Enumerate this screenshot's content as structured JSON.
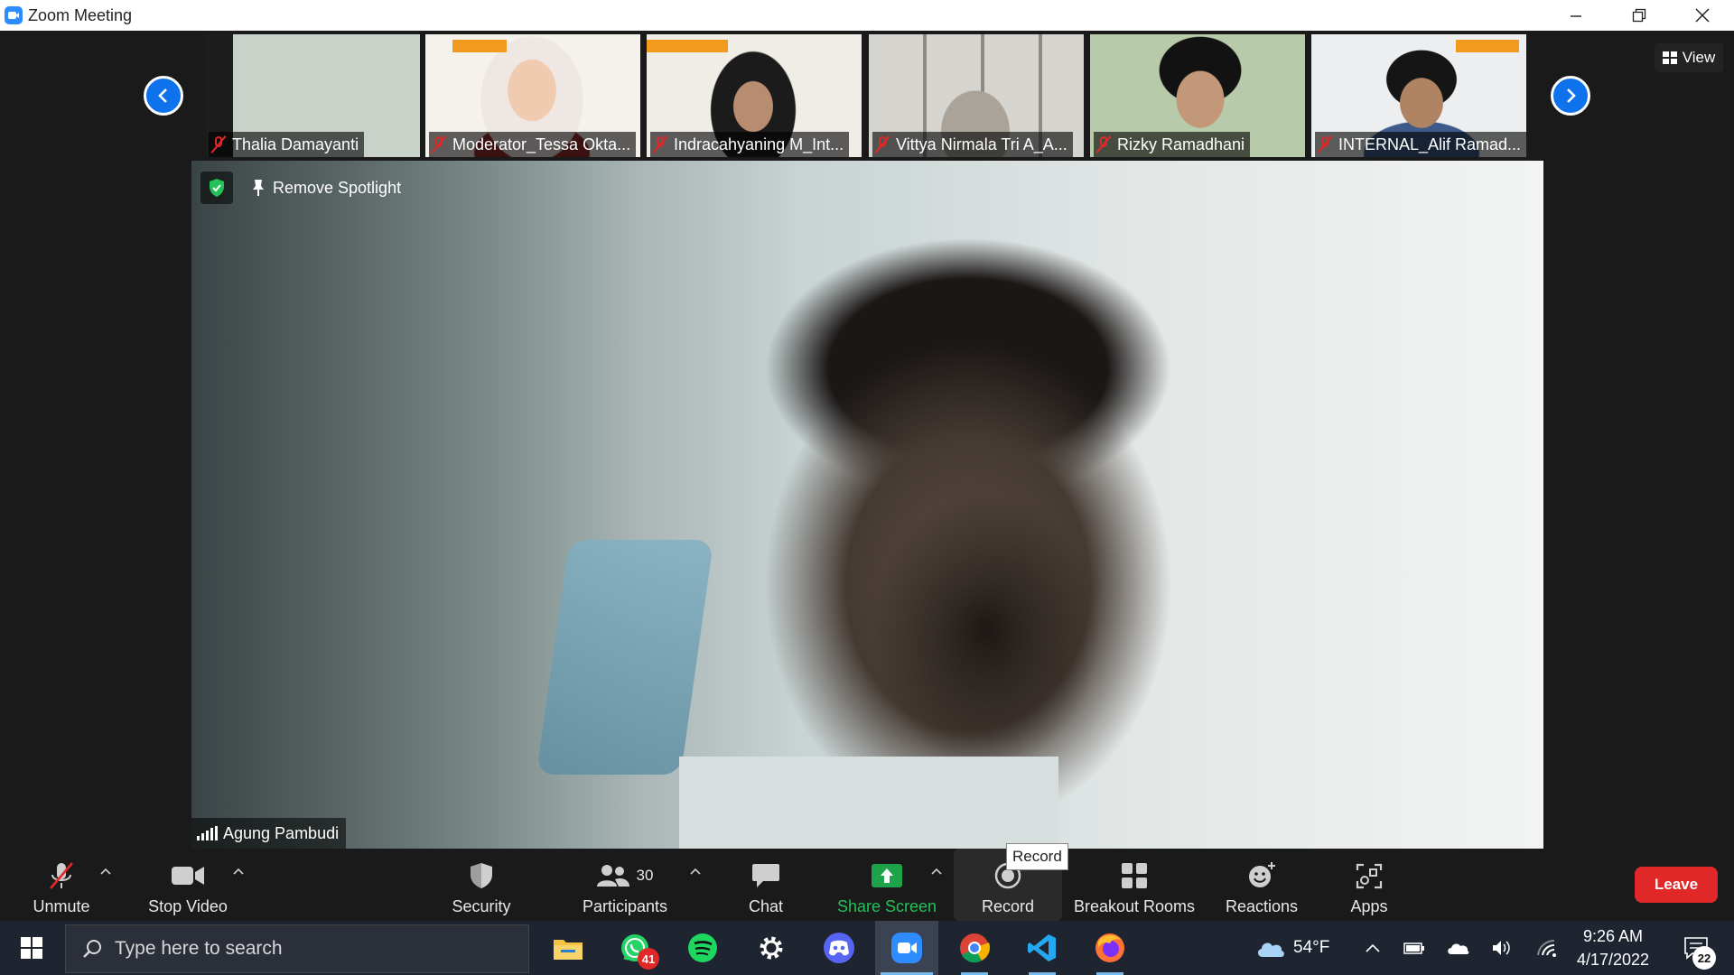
{
  "window": {
    "title": "Zoom Meeting"
  },
  "gallery": {
    "view_label": "View",
    "tiles": [
      {
        "name": "Thalia Damayanti",
        "bg": "#cfd6cf"
      },
      {
        "name": "Moderator_Tessa Okta...",
        "bg": "#f3f0ea"
      },
      {
        "name": "Indracahyaning M_Int...",
        "bg": "#f1ede7"
      },
      {
        "name": "Vittya Nirmala Tri A_A...",
        "bg": "#d8d6d0"
      },
      {
        "name": "Rizky Ramadhani",
        "bg": "#b8c9b3"
      },
      {
        "name": "INTERNAL_Alif Ramad...",
        "bg": "#e8e9ec"
      }
    ]
  },
  "speaker": {
    "name": "Agung Pambudi",
    "remove_spotlight_label": "Remove Spotlight"
  },
  "toolbar": {
    "unmute_label": "Unmute",
    "stop_video_label": "Stop Video",
    "security_label": "Security",
    "participants_label": "Participants",
    "participants_count": "30",
    "chat_label": "Chat",
    "share_screen_label": "Share Screen",
    "record_label": "Record",
    "record_tooltip": "Record",
    "breakout_label": "Breakout Rooms",
    "reactions_label": "Reactions",
    "apps_label": "Apps",
    "leave_label": "Leave"
  },
  "taskbar": {
    "search_placeholder": "Type here to search",
    "whatsapp_badge": "41",
    "weather_temp": "54°F",
    "time": "9:26 AM",
    "date": "4/17/2022",
    "notifications_count": "22"
  },
  "colors": {
    "zoom_blue": "#2d8cff",
    "leave_red": "#e02828",
    "share_green": "#1ea34b",
    "muted_red": "#e02828"
  }
}
